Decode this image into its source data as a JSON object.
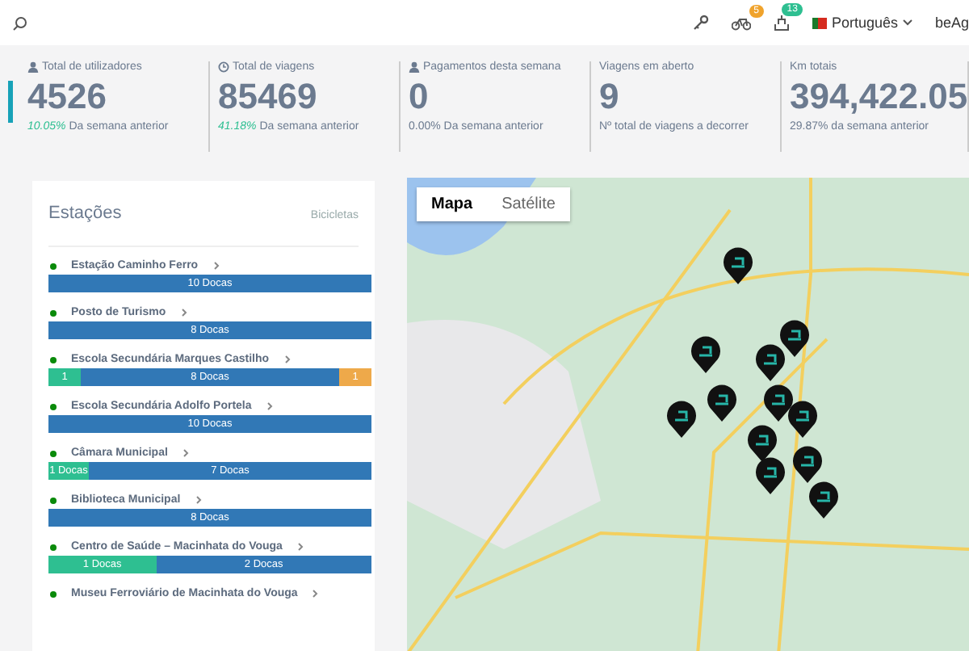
{
  "header": {
    "bike_badge": "5",
    "dock_badge": "13",
    "language": "Português",
    "user": "beAg"
  },
  "stats": [
    {
      "kind": "users",
      "label": "Total de utilizadores",
      "value": "4526",
      "change": "10.05%",
      "caption": "Da semana anterior"
    },
    {
      "kind": "trips",
      "label": "Total de viagens",
      "value": "85469",
      "change": "41.18%",
      "caption": "Da semana anterior"
    },
    {
      "kind": "payments",
      "label": "Pagamentos desta semana",
      "value": "0",
      "caption": "0.00% Da semana anterior"
    },
    {
      "kind": "open_trips",
      "label": "Viagens em aberto",
      "value": "9",
      "caption": "Nº total de viagens a decorrer"
    },
    {
      "kind": "distance",
      "label": "Km totais",
      "value": "394,422.05",
      "caption": "29.87% da semana anterior"
    }
  ],
  "stations_panel": {
    "title": "Estações",
    "tab": "Bicicletas",
    "stations": [
      {
        "name": "Estação Caminho Ferro",
        "segments": [
          {
            "kind": "docks",
            "label": "10 Docas"
          }
        ]
      },
      {
        "name": "Posto de Turismo",
        "segments": [
          {
            "kind": "docks",
            "label": "8 Docas"
          }
        ]
      },
      {
        "name": "Escola Secundária Marques Castilho",
        "segments": [
          {
            "kind": "bikes",
            "label": "1"
          },
          {
            "kind": "docks",
            "label": "8 Docas"
          },
          {
            "kind": "other",
            "label": "1"
          }
        ]
      },
      {
        "name": "Escola Secundária Adolfo Portela",
        "segments": [
          {
            "kind": "docks",
            "label": "10 Docas"
          }
        ]
      },
      {
        "name": "Câmara Municipal",
        "segments": [
          {
            "kind": "bikes",
            "label": "1 Docas"
          },
          {
            "kind": "docks",
            "label": "7 Docas"
          }
        ]
      },
      {
        "name": "Biblioteca Municipal",
        "segments": [
          {
            "kind": "docks",
            "label": "8 Docas"
          }
        ]
      },
      {
        "name": "Centro de Saúde – Macinhata do Vouga",
        "segments": [
          {
            "kind": "bikes",
            "label": "1 Docas"
          },
          {
            "kind": "docks",
            "label": "2 Docas"
          }
        ]
      },
      {
        "name": "Museu Ferroviário de Macinhata do Vouga"
      }
    ]
  },
  "map": {
    "modes": [
      {
        "label": "Mapa",
        "selected": true
      },
      {
        "label": "Satélite",
        "selected": false
      }
    ]
  }
}
